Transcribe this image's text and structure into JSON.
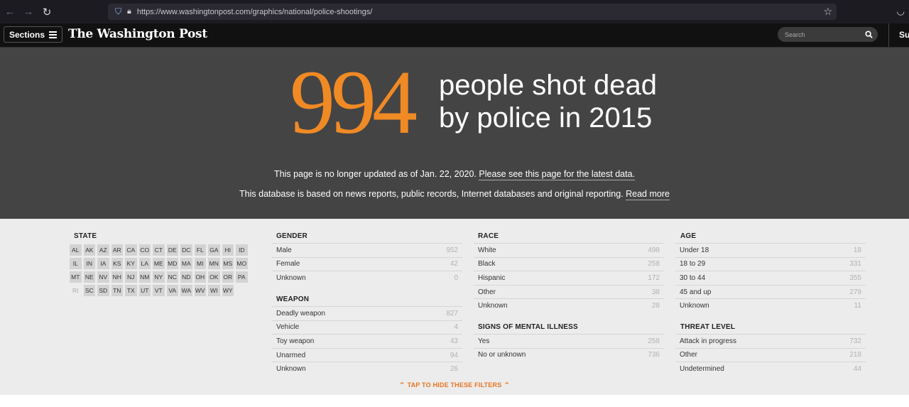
{
  "browser": {
    "url": "https://www.washingtonpost.com/graphics/national/police-shootings/",
    "back_icon": "←",
    "forward_icon": "→",
    "reload_icon": "↻"
  },
  "header": {
    "sections_label": "Sections",
    "logo": "The Washington Post",
    "search_placeholder": "Search",
    "subscribe_label": "Su"
  },
  "hero": {
    "number": "994",
    "headline_line1": "people shot dead",
    "headline_line2": "by police in 2015",
    "notice1_text": "This page is no longer updated as of Jan. 22, 2020.",
    "notice1_link": "Please see this page for the latest data.",
    "notice2_text": "This database is based on news reports, public records, Internet databases and original reporting.",
    "notice2_link": "Read more"
  },
  "filters": {
    "state_title": "STATE",
    "states": [
      "AL",
      "AK",
      "AZ",
      "AR",
      "CA",
      "CO",
      "CT",
      "DE",
      "DC",
      "FL",
      "GA",
      "HI",
      "ID",
      "IL",
      "IN",
      "IA",
      "KS",
      "KY",
      "LA",
      "ME",
      "MD",
      "MA",
      "MI",
      "MN",
      "MS",
      "MO",
      "MT",
      "NE",
      "NV",
      "NH",
      "NJ",
      "NM",
      "NY",
      "NC",
      "ND",
      "OH",
      "OK",
      "OR",
      "PA",
      "RI",
      "SC",
      "SD",
      "TN",
      "TX",
      "UT",
      "VT",
      "VA",
      "WA",
      "WV",
      "WI",
      "WY"
    ],
    "disabled_states": [
      "RI"
    ],
    "gender": {
      "title": "GENDER",
      "items": [
        {
          "label": "Male",
          "count": "952"
        },
        {
          "label": "Female",
          "count": "42"
        },
        {
          "label": "Unknown",
          "count": "0"
        }
      ]
    },
    "weapon": {
      "title": "WEAPON",
      "items": [
        {
          "label": "Deadly weapon",
          "count": "827"
        },
        {
          "label": "Vehicle",
          "count": "4"
        },
        {
          "label": "Toy weapon",
          "count": "43"
        },
        {
          "label": "Unarmed",
          "count": "94"
        },
        {
          "label": "Unknown",
          "count": "26"
        }
      ]
    },
    "race": {
      "title": "RACE",
      "items": [
        {
          "label": "White",
          "count": "498"
        },
        {
          "label": "Black",
          "count": "258"
        },
        {
          "label": "Hispanic",
          "count": "172"
        },
        {
          "label": "Other",
          "count": "38"
        },
        {
          "label": "Unknown",
          "count": "28"
        }
      ]
    },
    "mental": {
      "title": "SIGNS OF MENTAL ILLNESS",
      "items": [
        {
          "label": "Yes",
          "count": "258"
        },
        {
          "label": "No or unknown",
          "count": "736"
        }
      ]
    },
    "age": {
      "title": "AGE",
      "items": [
        {
          "label": "Under 18",
          "count": "18"
        },
        {
          "label": "18 to 29",
          "count": "331"
        },
        {
          "label": "30 to 44",
          "count": "355"
        },
        {
          "label": "45 and up",
          "count": "279"
        },
        {
          "label": "Unknown",
          "count": "11"
        }
      ]
    },
    "threat": {
      "title": "THREAT LEVEL",
      "items": [
        {
          "label": "Attack in progress",
          "count": "732"
        },
        {
          "label": "Other",
          "count": "218"
        },
        {
          "label": "Undetermined",
          "count": "44"
        }
      ]
    },
    "hide_label": "TAP TO HIDE THESE FILTERS"
  },
  "colors": {
    "accent": "#f08a24",
    "hero_bg": "#444444",
    "filters_bg": "#ececec",
    "header_bg": "#111111"
  }
}
